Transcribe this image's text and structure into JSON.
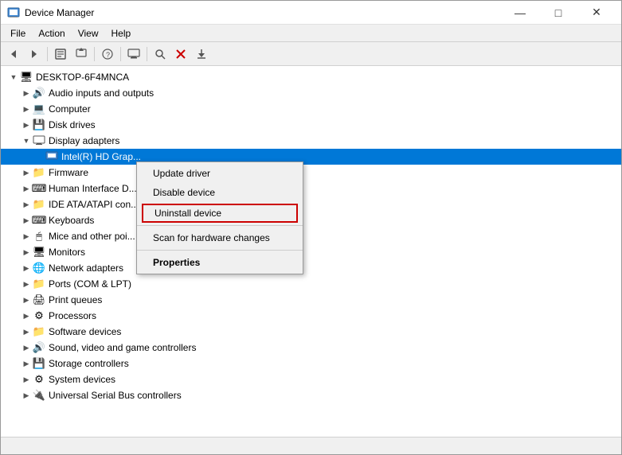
{
  "window": {
    "title": "Device Manager",
    "icon": "💻"
  },
  "titlebar": {
    "minimize": "—",
    "maximize": "□",
    "close": "✕"
  },
  "menu": {
    "items": [
      "File",
      "Action",
      "View",
      "Help"
    ]
  },
  "toolbar": {
    "buttons": [
      {
        "name": "back",
        "icon": "◀"
      },
      {
        "name": "forward",
        "icon": "▶"
      },
      {
        "name": "properties",
        "icon": "🗋"
      },
      {
        "name": "update-driver",
        "icon": "⬆"
      },
      {
        "name": "help",
        "icon": "?"
      },
      {
        "name": "scan",
        "icon": "🔍"
      },
      {
        "name": "device-manager",
        "icon": "🖥"
      },
      {
        "name": "uninstall",
        "icon": "✕"
      },
      {
        "name": "download",
        "icon": "⬇"
      }
    ]
  },
  "tree": {
    "root": "DESKTOP-6F4MNCA",
    "items": [
      {
        "id": "audio",
        "label": "Audio inputs and outputs",
        "indent": 1,
        "expanded": false,
        "icon": "🔊"
      },
      {
        "id": "computer",
        "label": "Computer",
        "indent": 1,
        "expanded": false,
        "icon": "💻"
      },
      {
        "id": "disk",
        "label": "Disk drives",
        "indent": 1,
        "expanded": false,
        "icon": "💾"
      },
      {
        "id": "display",
        "label": "Display adapters",
        "indent": 1,
        "expanded": true,
        "icon": "🖥"
      },
      {
        "id": "display-child",
        "label": "Intel(R) HD Grap...",
        "indent": 2,
        "expanded": false,
        "icon": "🖥",
        "selected": true
      },
      {
        "id": "firmware",
        "label": "Firmware",
        "indent": 1,
        "expanded": false,
        "icon": "📁"
      },
      {
        "id": "hid",
        "label": "Human Interface D...",
        "indent": 1,
        "expanded": false,
        "icon": "⌨"
      },
      {
        "id": "ide",
        "label": "IDE ATA/ATAPI con...",
        "indent": 1,
        "expanded": false,
        "icon": "📁"
      },
      {
        "id": "keyboards",
        "label": "Keyboards",
        "indent": 1,
        "expanded": false,
        "icon": "⌨"
      },
      {
        "id": "mice",
        "label": "Mice and other poi...",
        "indent": 1,
        "expanded": false,
        "icon": "🖱"
      },
      {
        "id": "monitors",
        "label": "Monitors",
        "indent": 1,
        "expanded": false,
        "icon": "🖥"
      },
      {
        "id": "network",
        "label": "Network adapters",
        "indent": 1,
        "expanded": false,
        "icon": "🌐"
      },
      {
        "id": "ports",
        "label": "Ports (COM & LPT)",
        "indent": 1,
        "expanded": false,
        "icon": "📁"
      },
      {
        "id": "print",
        "label": "Print queues",
        "indent": 1,
        "expanded": false,
        "icon": "🖨"
      },
      {
        "id": "processors",
        "label": "Processors",
        "indent": 1,
        "expanded": false,
        "icon": "⚙"
      },
      {
        "id": "software",
        "label": "Software devices",
        "indent": 1,
        "expanded": false,
        "icon": "📁"
      },
      {
        "id": "sound",
        "label": "Sound, video and game controllers",
        "indent": 1,
        "expanded": false,
        "icon": "🔊"
      },
      {
        "id": "storage",
        "label": "Storage controllers",
        "indent": 1,
        "expanded": false,
        "icon": "💾"
      },
      {
        "id": "system",
        "label": "System devices",
        "indent": 1,
        "expanded": false,
        "icon": "⚙"
      },
      {
        "id": "usb",
        "label": "Universal Serial Bus controllers",
        "indent": 1,
        "expanded": false,
        "icon": "🔌"
      }
    ]
  },
  "context_menu": {
    "items": [
      {
        "id": "update-driver",
        "label": "Update driver",
        "type": "normal"
      },
      {
        "id": "disable-device",
        "label": "Disable device",
        "type": "normal"
      },
      {
        "id": "uninstall-device",
        "label": "Uninstall device",
        "type": "uninstall"
      },
      {
        "id": "separator1",
        "type": "separator"
      },
      {
        "id": "scan-changes",
        "label": "Scan for hardware changes",
        "type": "normal"
      },
      {
        "id": "separator2",
        "type": "separator"
      },
      {
        "id": "properties",
        "label": "Properties",
        "type": "bold"
      }
    ]
  }
}
